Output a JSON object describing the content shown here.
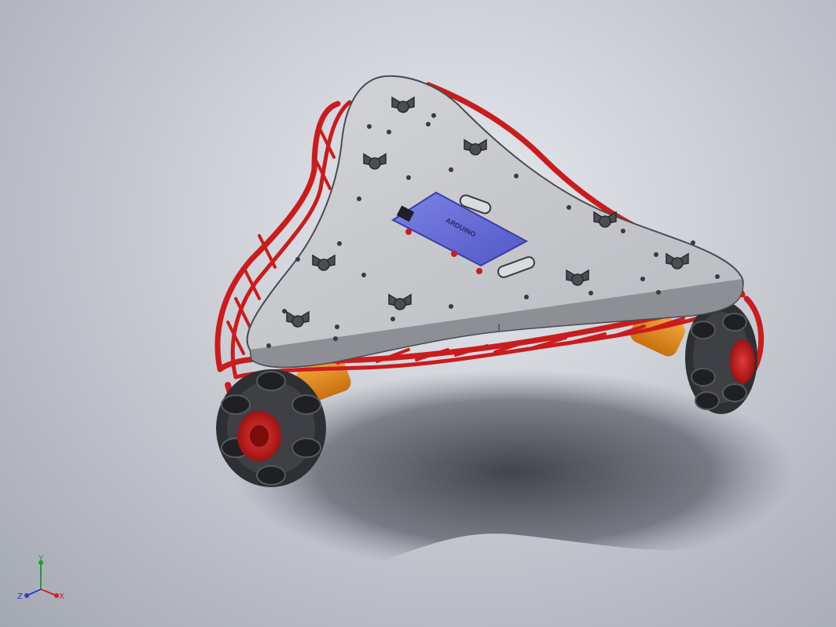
{
  "viewport": {
    "background_top": "#e6e9ee",
    "background_bottom": "#a4a8b2"
  },
  "model": {
    "frame_color": "#c91d1d",
    "plate_color": "#c6c8cc",
    "board_color": "#6a6fd8",
    "board_text": "ARDUINO",
    "motor_color": "#e88a1e",
    "wheel_color": "#2e2f33"
  },
  "triad": {
    "x_label": "X",
    "y_label": "Y",
    "z_label": "Z",
    "x_color": "#d22020",
    "y_color": "#1e9e2a",
    "z_color": "#2a3ccf"
  }
}
